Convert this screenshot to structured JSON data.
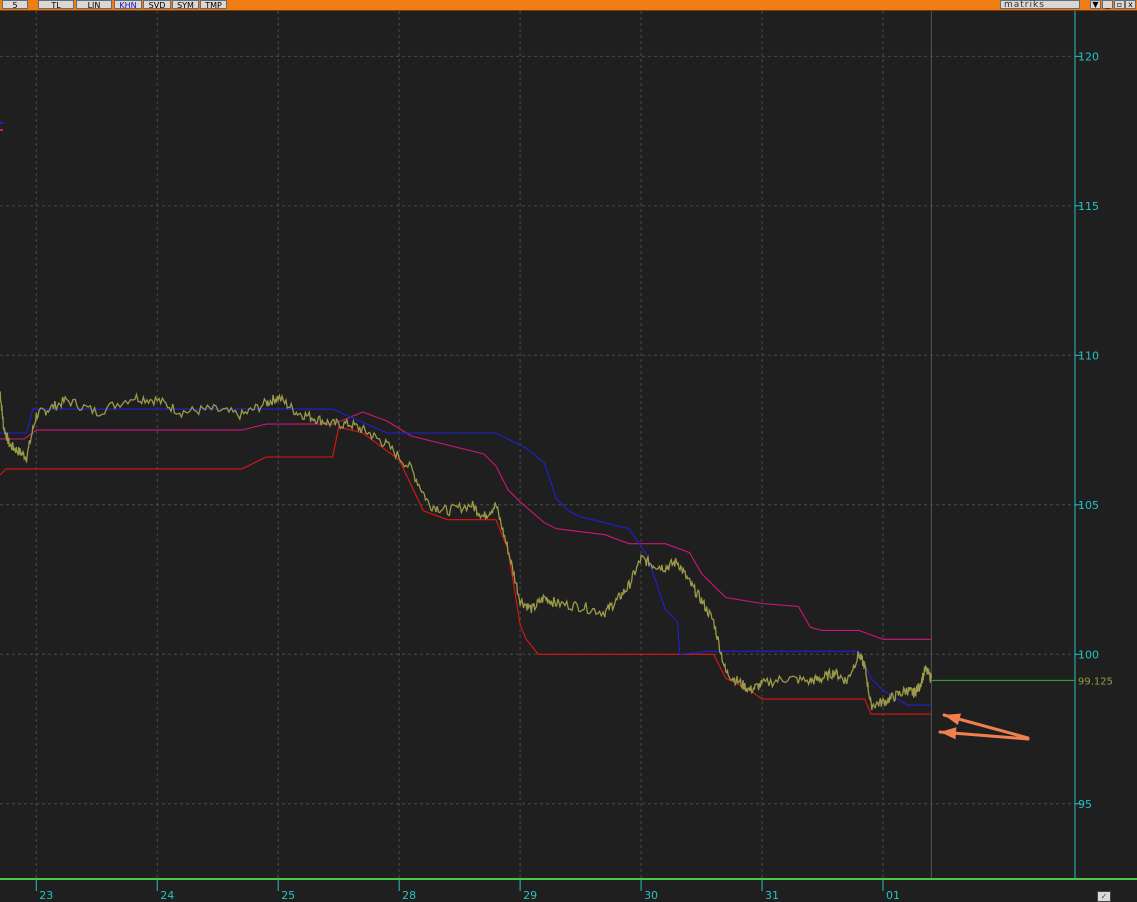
{
  "toolbar": {
    "buttons": [
      {
        "label": "5",
        "active": false
      },
      {
        "label": "TL",
        "active": false
      },
      {
        "label": "LIN",
        "active": false
      },
      {
        "label": "KHN",
        "active": true
      },
      {
        "label": "SVD",
        "active": false
      },
      {
        "label": "SYM",
        "active": false
      },
      {
        "label": "TMP",
        "active": false
      }
    ],
    "brand": "matriks",
    "window_buttons": [
      "▼",
      "_",
      "▫",
      "x"
    ]
  },
  "colors": {
    "background": "#1f1f1f",
    "grid": "#4a4a4a",
    "axis_text": "#25c2c2",
    "price": "#9a9a4a",
    "blue_line": "#2020d0",
    "magenta_line": "#d0157a",
    "red_line": "#e01515",
    "last_price_line": "#30b030",
    "arrow": "#f08050"
  },
  "chart_data": {
    "type": "line",
    "ylim": [
      92.5,
      121.5
    ],
    "yticks": [
      120,
      115,
      110,
      105,
      100,
      95
    ],
    "ytick_labels": [
      "120",
      "115",
      "110",
      "105",
      "100",
      "95"
    ],
    "x_range": [
      0,
      9.4
    ],
    "xticks": [
      0.3,
      1.3,
      2.3,
      3.3,
      4.3,
      5.3,
      6.3,
      7.3
    ],
    "xtick_labels": [
      "23",
      "24",
      "25",
      "28",
      "29",
      "30",
      "31",
      "01"
    ],
    "last_price": 99.125,
    "last_price_label": "99.125",
    "series": [
      {
        "key": "price",
        "x": [
          0,
          0.03,
          0.08,
          0.15,
          0.22,
          0.3,
          0.4,
          0.55,
          0.8,
          1.1,
          1.3,
          1.5,
          1.75,
          2.0,
          2.2,
          2.3,
          2.45,
          2.6,
          2.75,
          2.9,
          3.05,
          3.2,
          3.4,
          3.55,
          3.7,
          3.9,
          4.0,
          4.1,
          4.2,
          4.3,
          4.4,
          4.5,
          4.6,
          4.8,
          5.0,
          5.1,
          5.2,
          5.3,
          5.4,
          5.5,
          5.6,
          5.7,
          5.8,
          5.9,
          6.0,
          6.1,
          6.2,
          6.3,
          6.5,
          6.7,
          6.8,
          6.9,
          7.0,
          7.1,
          7.15,
          7.2,
          7.3,
          7.4,
          7.5,
          7.55,
          7.6,
          7.65,
          7.7
        ],
        "y": [
          108.8,
          107.6,
          107.0,
          106.8,
          106.6,
          108.0,
          108.2,
          108.5,
          108.1,
          108.6,
          108.5,
          108.1,
          108.2,
          108.0,
          108.4,
          108.6,
          108.1,
          107.9,
          107.7,
          107.7,
          107.4,
          107.0,
          106.2,
          105.0,
          104.8,
          105.0,
          104.6,
          105.0,
          103.5,
          101.8,
          101.5,
          101.9,
          101.7,
          101.6,
          101.4,
          101.8,
          102.3,
          103.2,
          103.0,
          102.9,
          103.1,
          102.4,
          101.8,
          101.1,
          99.4,
          99.1,
          98.8,
          99.0,
          99.2,
          99.1,
          99.2,
          99.4,
          99.1,
          100.0,
          99.6,
          98.3,
          98.4,
          98.6,
          98.8,
          98.7,
          98.9,
          99.5,
          99.2
        ]
      },
      {
        "key": "blue",
        "x": [
          0,
          0.22,
          0.27,
          2.75,
          3.2,
          4.1,
          4.2,
          4.35,
          4.5,
          4.6,
          4.7,
          4.8,
          5.2,
          5.35,
          5.5,
          5.6,
          5.62,
          5.85,
          7.1,
          7.2,
          7.3,
          7.5,
          7.7
        ],
        "y": [
          107.4,
          107.4,
          108.2,
          108.2,
          107.4,
          107.4,
          107.2,
          106.9,
          106.4,
          105.2,
          104.8,
          104.6,
          104.2,
          103.3,
          101.5,
          101.1,
          100.0,
          100.1,
          100.1,
          99.2,
          98.8,
          98.3,
          98.3
        ]
      },
      {
        "key": "magenta",
        "x": [
          0,
          0.2,
          0.3,
          2.0,
          2.2,
          2.75,
          3.0,
          3.2,
          3.4,
          3.7,
          4.0,
          4.1,
          4.2,
          4.3,
          4.5,
          4.6,
          5.0,
          5.2,
          5.5,
          5.7,
          5.8,
          5.9,
          6.0,
          6.3,
          6.6,
          6.7,
          6.8,
          7.1,
          7.3,
          7.7
        ],
        "y": [
          107.2,
          107.2,
          107.5,
          107.5,
          107.7,
          107.7,
          108.1,
          107.8,
          107.3,
          107.0,
          106.7,
          106.3,
          105.5,
          105.1,
          104.4,
          104.2,
          104.0,
          103.7,
          103.7,
          103.4,
          102.7,
          102.3,
          101.9,
          101.7,
          101.6,
          100.9,
          100.8,
          100.8,
          100.5,
          100.5
        ]
      },
      {
        "key": "red",
        "x": [
          0,
          0.05,
          2.0,
          2.2,
          2.75,
          2.8,
          3.0,
          3.3,
          3.5,
          3.7,
          4.1,
          4.2,
          4.3,
          4.35,
          4.45,
          5.9,
          6.0,
          6.2,
          6.3,
          7.15,
          7.2,
          7.7
        ],
        "y": [
          106.0,
          106.2,
          106.2,
          106.6,
          106.6,
          107.6,
          107.4,
          106.5,
          104.8,
          104.5,
          104.5,
          103.5,
          101.0,
          100.5,
          100.0,
          100.0,
          99.2,
          98.8,
          98.5,
          98.5,
          98.0,
          98.0
        ]
      }
    ]
  }
}
